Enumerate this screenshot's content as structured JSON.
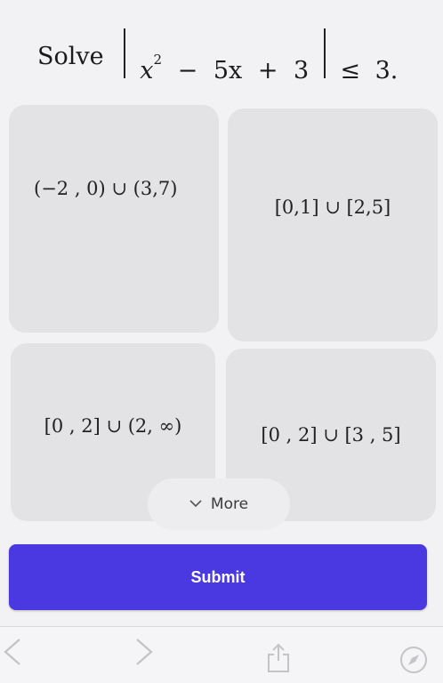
{
  "question": {
    "prefix": "Solve",
    "var_x": "x",
    "exponent": "2",
    "minus": "−",
    "term_5x": "5x",
    "plus": "+",
    "const_3": "3",
    "relation": "≤",
    "rhs": "3."
  },
  "options": [
    {
      "label": "(−2 , 0) ∪ (3,7)"
    },
    {
      "label": "[0,1] ∪ [2,5]"
    },
    {
      "label": "[0 , 2] ∪ (2, ∞)"
    },
    {
      "label": "[0 , 2] ∪ [3 , 5]"
    }
  ],
  "more": {
    "label": "More",
    "icon": "chevron-down-icon"
  },
  "submit": {
    "label": "Submit"
  },
  "toolbar": {
    "icons": [
      "back-chevron-icon",
      "forward-chevron-icon",
      "share-icon",
      "compass-icon"
    ],
    "icon_color": "#c4c4c8"
  },
  "colors": {
    "accent": "#4a39e0",
    "card": "#e3e3e6",
    "background": "#f2f2f4"
  }
}
